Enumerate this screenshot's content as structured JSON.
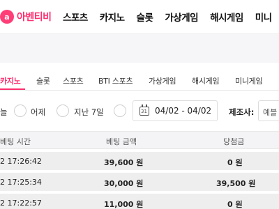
{
  "header": {
    "logo_icon_text": "a",
    "logo_text": "아벤티비",
    "nav": [
      "스포츠",
      "카지노",
      "슬롯",
      "가상게임",
      "해시게임",
      "미니"
    ]
  },
  "subtabs": {
    "items": [
      "카지노",
      "슬롯",
      "스포츠",
      "BTI 스포츠",
      "가상게임",
      "해시게임",
      "미니게임"
    ],
    "active": "카지노"
  },
  "filters": {
    "partial_label": "늘",
    "yesterday_label": "어제",
    "last7_label": "지난 7일",
    "date_range": "04/02 - 04/02",
    "calendar_number": "31",
    "maker_label": "제조사:",
    "maker_value": "예블"
  },
  "table": {
    "headers": {
      "time": "베팅 시간",
      "amount": "베팅 금액",
      "win": "당첨금"
    },
    "rows": [
      {
        "time": "2 17:26:42",
        "amount": "39,600 원",
        "win": "0 원"
      },
      {
        "time": "2 17:25:34",
        "amount": "30,000 원",
        "win": "39,500 원"
      },
      {
        "time": "2 17:22:57",
        "amount": "11,000 원",
        "win": "0 원"
      }
    ]
  }
}
